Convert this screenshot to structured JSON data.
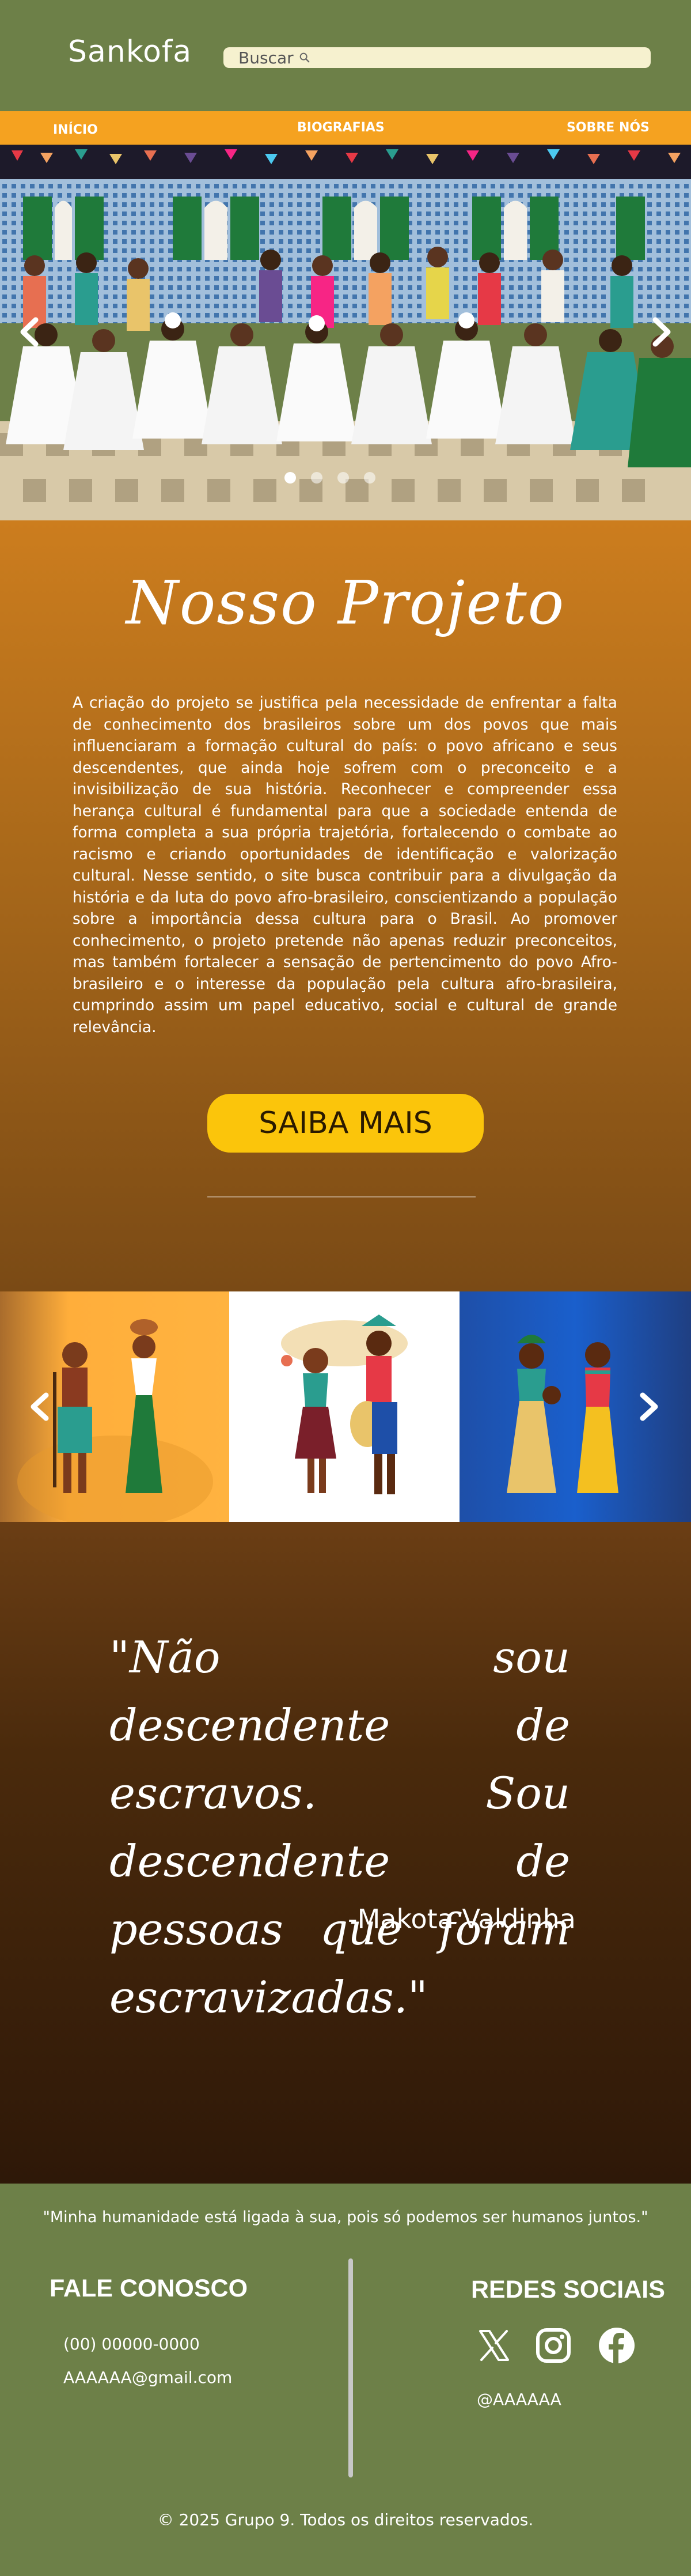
{
  "header": {
    "logo": "Sankofa",
    "search": {
      "placeholder": "Buscar"
    }
  },
  "nav": {
    "items": [
      {
        "label": "INÍCIO"
      },
      {
        "label": "BIOGRAFIAS"
      },
      {
        "label": "SOBRE NÓS"
      }
    ]
  },
  "hero": {
    "image": "painting-afro-brazilian-baianas-celebration",
    "slide_count": 4,
    "active_slide": 1,
    "prev_icon": "chevron-left-icon",
    "next_icon": "chevron-right-icon"
  },
  "project": {
    "title": "Nosso Projeto",
    "text": "A criação do projeto se justifica pela necessidade de enfrentar a falta de conhecimento dos brasileiros sobre um dos povos que mais influenciaram a formação cultural do país: o povo africano e seus descendentes, que ainda hoje sofrem com o preconceito e a invisibilização de sua história. Reconhecer e compreender essa herança cultural é fundamental para que a sociedade entenda de forma completa a sua própria trajetória, fortalecendo o combate ao racismo e criando oportunidades de identificação e valorização cultural. Nesse sentido, o site busca contribuir para a divulgação da história e da luta do povo afro-brasileiro, conscientizando a população sobre a importância dessa cultura para o Brasil. Ao promover conhecimento, o projeto pretende não apenas reduzir preconceitos, mas também fortalecer a sensação de pertencimento do povo Afro-brasileiro e o interesse da população pela cultura afro-brasileira, cumprindo assim um papel educativo, social e cultural de grande relevância.",
    "button": "SAIBA MAIS"
  },
  "illustrations": {
    "panels": [
      {
        "image": "african-couple-illustration",
        "bg": "#ffae3b"
      },
      {
        "image": "african-musicians-illustration",
        "bg": "#ffffff"
      },
      {
        "image": "african-women-illustration",
        "bg": "#1a5fcc"
      }
    ]
  },
  "quote": {
    "text": "\"Não sou descendente de escravos. Sou descendente de pessoas que foram escravizadas.\"",
    "author": "-Makota Valdinha"
  },
  "footer": {
    "motto": "\"Minha humanidade está ligada à sua, pois só podemos ser humanos juntos.\"",
    "contact": {
      "title": "FALE CONOSCO",
      "phone": "(00) 00000-0000",
      "email": "AAAAAA@gmail.com"
    },
    "social": {
      "title": "REDES SOCIAIS",
      "icons": [
        "x-icon",
        "instagram-icon",
        "facebook-icon"
      ],
      "handle": "@AAAAAA"
    },
    "copyright": "© 2025 Grupo 9. Todos os direitos reservados."
  },
  "colors": {
    "header_green": "#6d8048",
    "nav_orange": "#f5a220",
    "button_yellow": "#fbc50b",
    "search_bg": "#f6f1cf"
  }
}
